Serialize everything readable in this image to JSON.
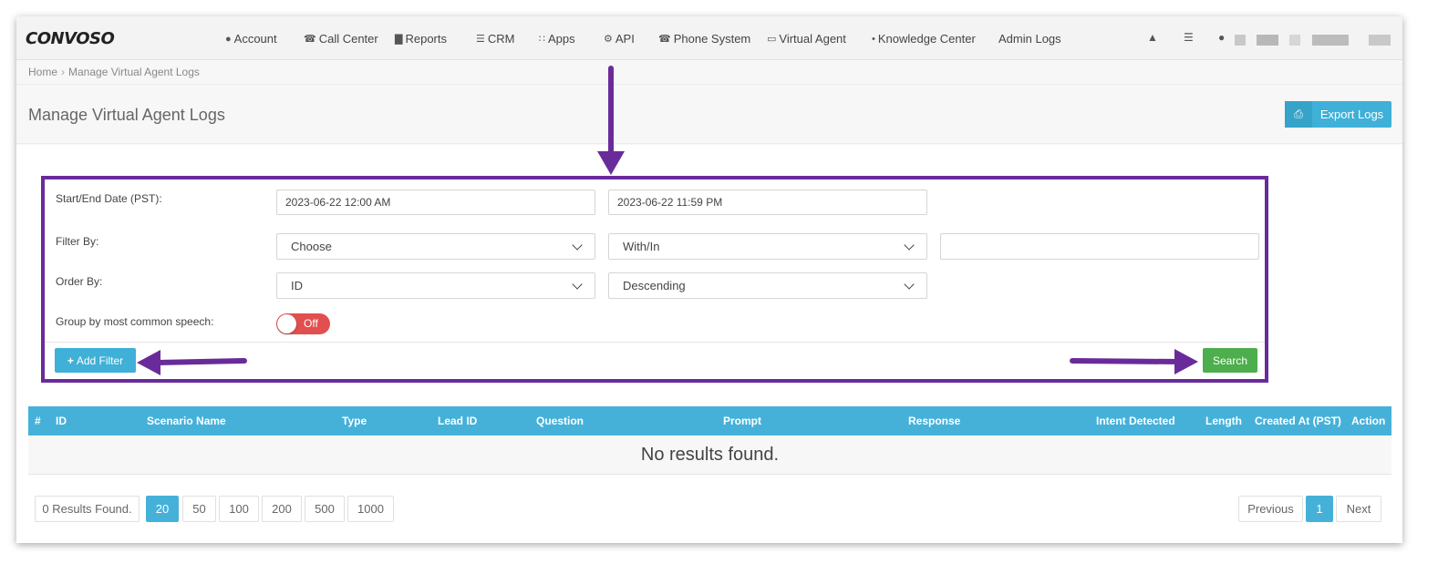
{
  "nav": {
    "logo": "CONVOSO",
    "items": [
      {
        "icon": "user-icon",
        "glyph": "●",
        "label": "Account"
      },
      {
        "icon": "phone-icon",
        "glyph": "☎",
        "label": "Call Center"
      },
      {
        "icon": "bar-chart-icon",
        "glyph": "▇",
        "label": "Reports"
      },
      {
        "icon": "list-icon",
        "glyph": "☰",
        "label": "CRM"
      },
      {
        "icon": "grid-icon",
        "glyph": "∷",
        "label": "Apps"
      },
      {
        "icon": "gear-icon",
        "glyph": "⚙",
        "label": "API"
      },
      {
        "icon": "phone-icon",
        "glyph": "☎",
        "label": "Phone System"
      },
      {
        "icon": "monitor-icon",
        "glyph": "▭",
        "label": "Virtual Agent"
      },
      {
        "icon": "lightbulb-icon",
        "glyph": "•",
        "label": "Knowledge Center"
      },
      {
        "icon": "",
        "glyph": "",
        "label": "Admin Logs"
      }
    ],
    "right_icons": [
      "bell-icon",
      "database-icon",
      "user-icon"
    ]
  },
  "breadcrumb": {
    "home": "Home",
    "separator": "›",
    "current": "Manage Virtual Agent Logs"
  },
  "page": {
    "title": "Manage Virtual Agent Logs",
    "export_label": "Export Logs",
    "export_icon": "print-icon"
  },
  "filters": {
    "date_label": "Start/End Date (PST):",
    "start_date": "2023-06-22 12:00 AM",
    "end_date": "2023-06-22 11:59 PM",
    "filter_label": "Filter By:",
    "filter_field": "Choose",
    "filter_operator": "With/In",
    "filter_value": "",
    "order_label": "Order By:",
    "order_field": "ID",
    "order_direction": "Descending",
    "group_label": "Group by most common speech:",
    "group_toggle": "Off",
    "add_filter_label": "Add Filter",
    "search_label": "Search"
  },
  "table": {
    "columns": [
      "#",
      "ID",
      "Scenario Name",
      "Type",
      "Lead ID",
      "Question",
      "Prompt",
      "Response",
      "Intent Detected",
      "Length",
      "Created At (PST)",
      "Action"
    ],
    "empty_message": "No results found."
  },
  "pagination": {
    "results_text": "0 Results Found.",
    "page_sizes": [
      "20",
      "50",
      "100",
      "200",
      "500",
      "1000"
    ],
    "selected_page_size": "20",
    "previous_label": "Previous",
    "current_page": "1",
    "next_label": "Next"
  },
  "colors": {
    "accent": "#45b1d9",
    "search_green": "#4cae4c",
    "toggle_off_red": "#e24f4f",
    "annotation_purple": "#6a2b9a"
  }
}
